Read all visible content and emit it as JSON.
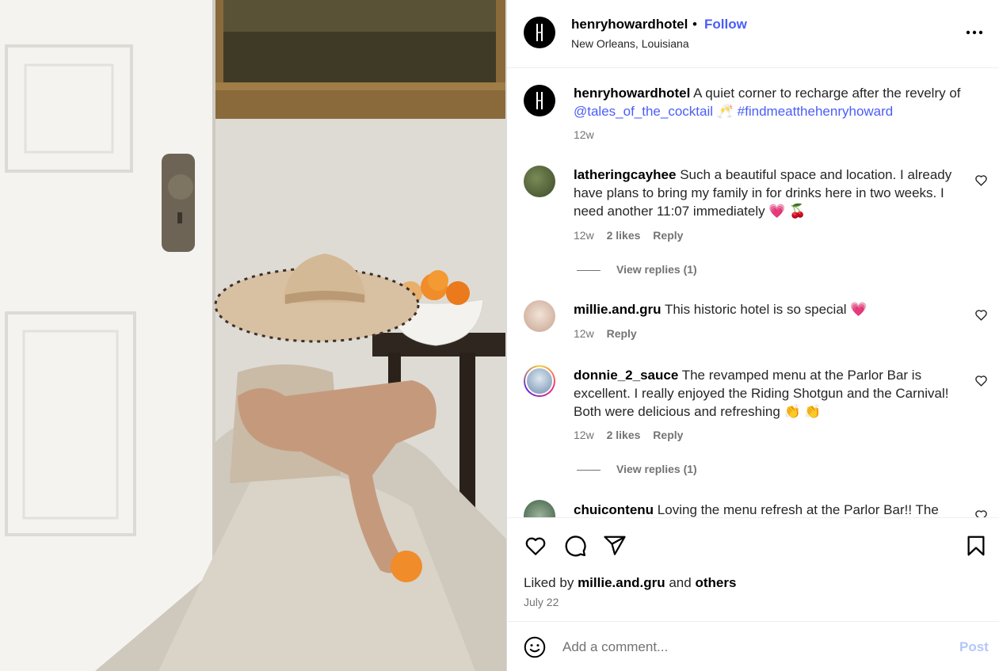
{
  "photo": {
    "alt_subject": "woman in straw hat seated on floor beside door and fruit bowl"
  },
  "post": {
    "username": "henryhowardhotel",
    "separator": "•",
    "follow_label": "Follow",
    "location": "New Orleans, Louisiana",
    "more_icon": "more-horizontal-icon"
  },
  "caption": {
    "username": "henryhowardhotel",
    "text": "A quiet corner to recharge after the revelry of",
    "mention": "@tales_of_the_cocktail",
    "emoji": "🥂",
    "hashtag": "#findmeatthehenryhoward",
    "age": "12w"
  },
  "comments": [
    {
      "username": "latheringcayhee",
      "text": "Such a beautiful space and location. I already have plans to bring my family in for drinks here in two weeks. I need another 11:07 immediately 💗 🍒",
      "age": "12w",
      "likes": "2 likes",
      "reply": "Reply",
      "view_replies": "View replies (1)"
    },
    {
      "username": "millie.and.gru",
      "text": "This historic hotel is so special 💗",
      "age": "12w",
      "reply": "Reply"
    },
    {
      "username": "donnie_2_sauce",
      "text": "The revamped menu at the Parlor Bar is excellent. I really enjoyed the Riding Shotgun and the Carnival! Both were delicious and refreshing 👏 👏",
      "age": "12w",
      "likes": "2 likes",
      "reply": "Reply",
      "view_replies": "View replies (1)"
    },
    {
      "username": "chuicontenu",
      "text": "Loving the menu refresh at the Parlor Bar!! The"
    }
  ],
  "actions": {
    "like_icon": "heart-icon",
    "comment_icon": "comment-icon",
    "share_icon": "share-icon",
    "save_icon": "bookmark-icon"
  },
  "liked_by": {
    "prefix": "Liked by",
    "user": "millie.and.gru",
    "middle": "and",
    "others": "others"
  },
  "date": "July 22",
  "add_comment": {
    "placeholder": "Add a comment...",
    "post_label": "Post",
    "emoji_icon": "smiley-icon"
  },
  "colors": {
    "link": "#4a5df9",
    "post_disabled": "#b2c7fb",
    "secondary_text": "#737373"
  }
}
